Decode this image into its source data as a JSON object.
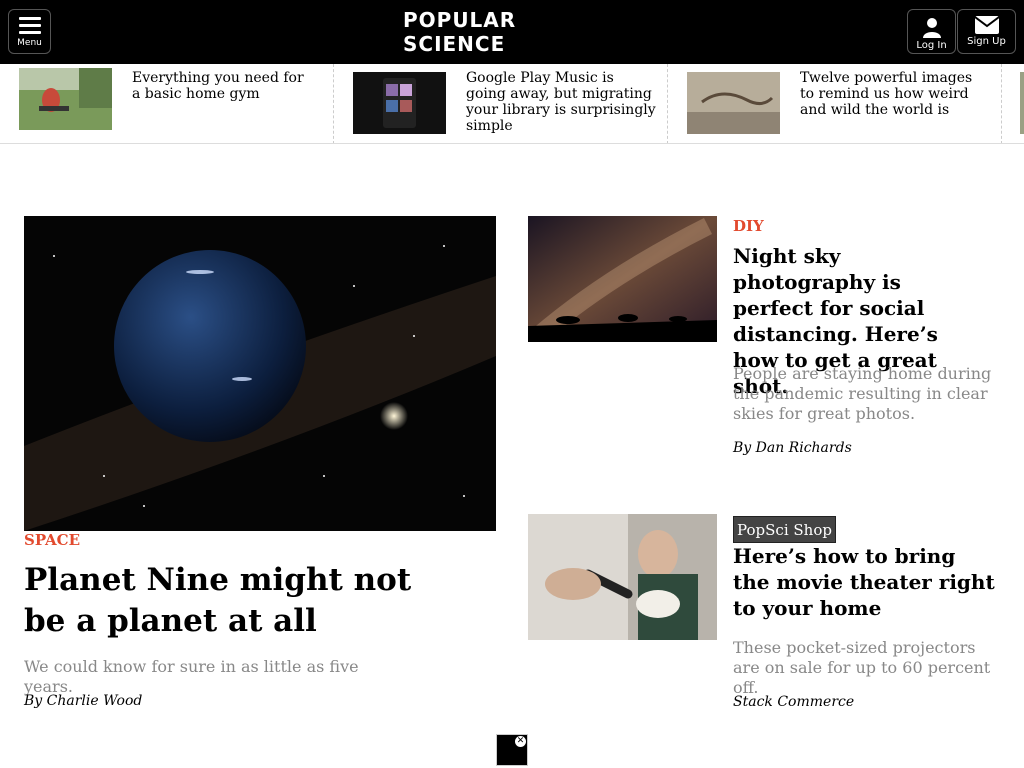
{
  "header": {
    "menu_label": "Menu",
    "logo_text": "POPULAR SCIENCE",
    "login_label": "Log In",
    "signup_label": "Sign Up"
  },
  "strip": {
    "items": [
      {
        "title": "Everything you need for a basic home gym"
      },
      {
        "title": "Google Play Music is going away, but migrating your library is surprisingly simple"
      },
      {
        "title": "Twelve powerful images to remind us how weird and wild the world is"
      }
    ]
  },
  "main": {
    "lead": {
      "tag": "SPACE",
      "headline": "Planet Nine might not be a planet at all",
      "deck": "We could know for sure in as little as five years.",
      "byline": "By Charlie Wood"
    },
    "story1": {
      "tag": "DIY",
      "headline": "Night sky photography is perfect for social distancing. Here’s how to get a great shot.",
      "deck": "People are staying home during the pandemic resulting in clear skies for great photos.",
      "byline": "By Dan Richards"
    },
    "story2": {
      "badge": "PopSci Shop",
      "headline": "Here’s how to bring the movie theater right to your home",
      "deck": "These pocket-sized projectors are on sale for up to 60 percent off.",
      "byline": "Stack Commerce"
    }
  },
  "ad": {
    "close_glyph": "✕"
  },
  "colors": {
    "header_bg": "#000000",
    "tag": "#e24a2e",
    "deck": "#888888",
    "shop_bg": "#444444"
  }
}
